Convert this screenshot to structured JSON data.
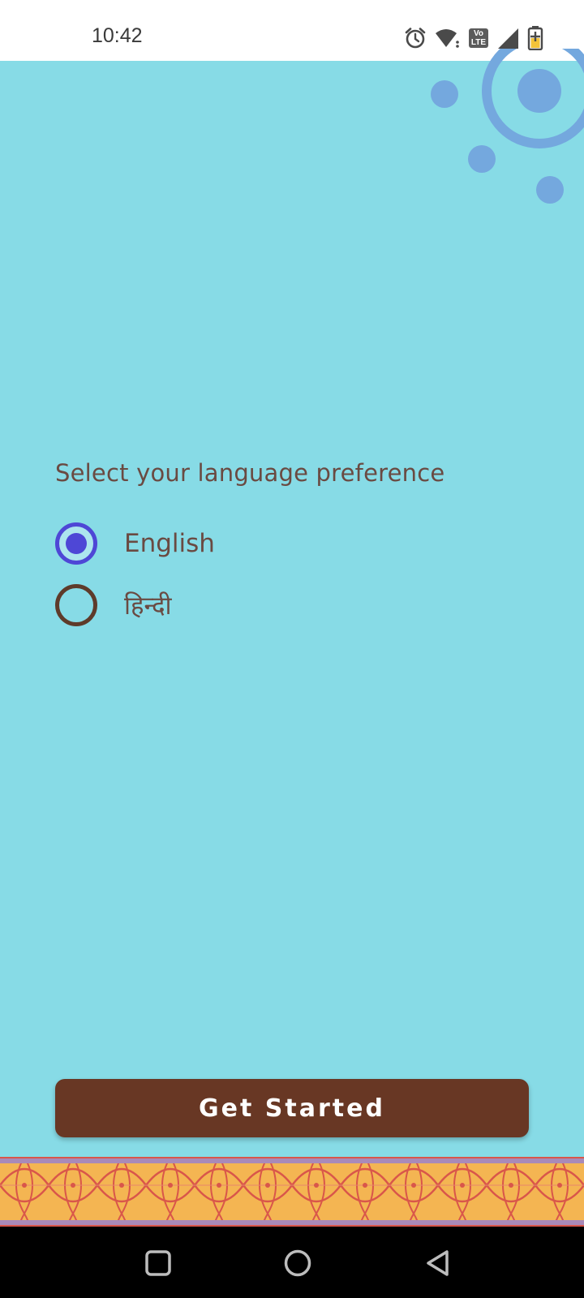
{
  "status_bar": {
    "time": "10:42",
    "icons": [
      "alarm-icon",
      "wifi-icon",
      "volte-icon",
      "cell-signal-icon",
      "battery-charging-icon"
    ],
    "volte_text": "Vo LTE"
  },
  "main": {
    "prompt": "Select your language preference",
    "options": [
      {
        "label": "English",
        "selected": true
      },
      {
        "label": "हिन्दी",
        "selected": false
      }
    ],
    "get_started_label": "Get Started"
  },
  "colors": {
    "background": "#87DBE6",
    "accent_radio": "#4E47D6",
    "text": "#6A4A42",
    "button": "#683724",
    "decor_circles": "#74A8DE",
    "pattern_base": "#F4B552",
    "pattern_line": "#D9564A",
    "pattern_border": "#A98AB8"
  },
  "nav_bar": {
    "buttons": [
      "recent-apps-icon",
      "home-icon",
      "back-icon"
    ]
  }
}
